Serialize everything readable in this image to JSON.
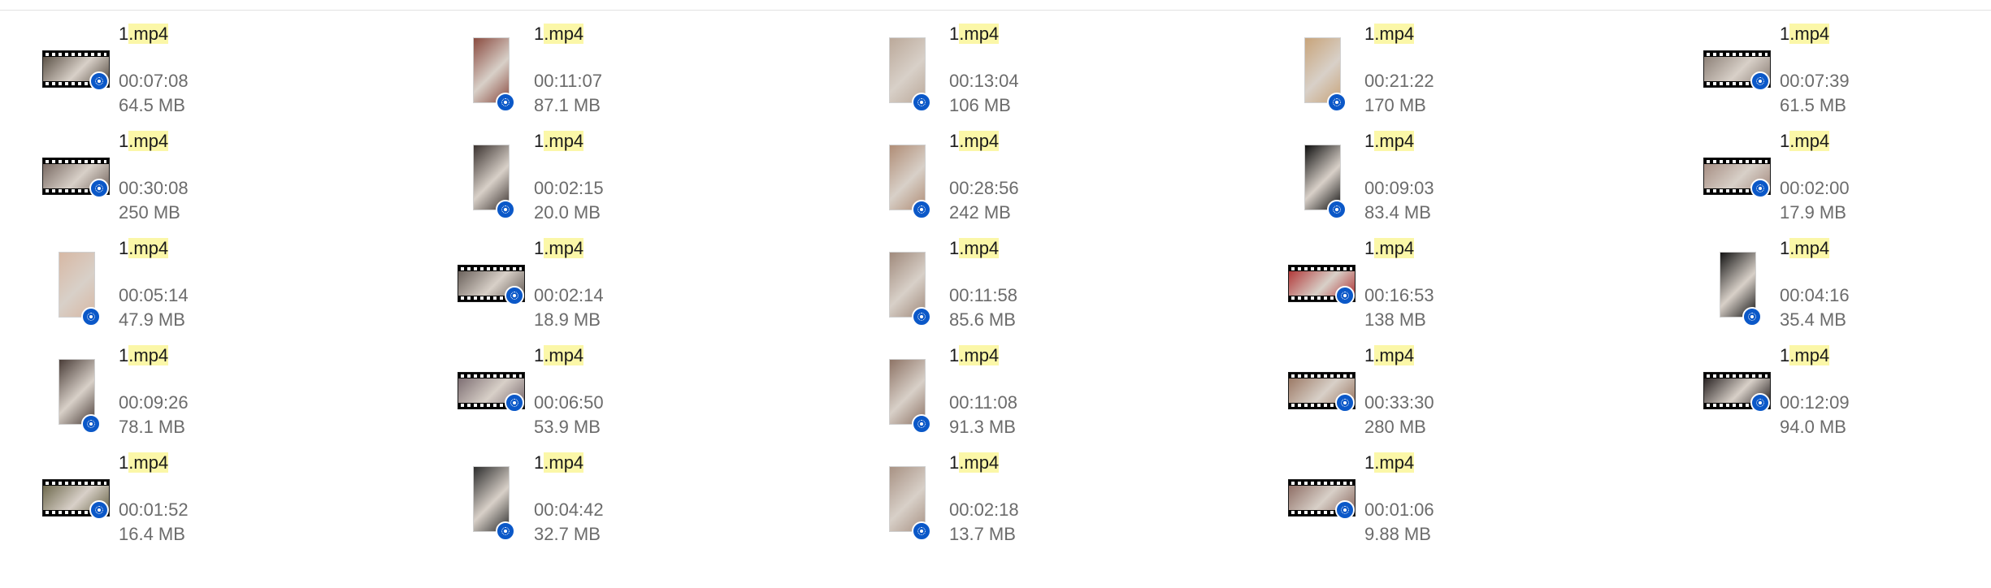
{
  "file_view": {
    "files": [
      {
        "name_prefix": "1",
        "name_highlight": ".mp4",
        "duration": "00:07:08",
        "size": "64.5 MB",
        "thumb_orientation": "landscape",
        "thumb_color": "#5d5348",
        "icon": "video-player-badge-icon"
      },
      {
        "name_prefix": "1",
        "name_highlight": ".mp4",
        "duration": "00:11:07",
        "size": "87.1 MB",
        "thumb_orientation": "portrait",
        "thumb_color": "#8a4b40",
        "icon": "video-player-badge-icon"
      },
      {
        "name_prefix": "1",
        "name_highlight": ".mp4",
        "duration": "00:13:04",
        "size": "106 MB",
        "thumb_orientation": "portrait",
        "thumb_color": "#bba99a",
        "icon": "video-player-badge-icon"
      },
      {
        "name_prefix": "1",
        "name_highlight": ".mp4",
        "duration": "00:21:22",
        "size": "170 MB",
        "thumb_orientation": "portrait",
        "thumb_color": "#c8a47a",
        "icon": "video-player-badge-icon"
      },
      {
        "name_prefix": "1",
        "name_highlight": ".mp4",
        "duration": "00:07:39",
        "size": "61.5 MB",
        "thumb_orientation": "landscape",
        "thumb_color": "#8d8178",
        "icon": "video-player-badge-icon"
      },
      {
        "name_prefix": "1",
        "name_highlight": ".mp4",
        "duration": "00:30:08",
        "size": "250 MB",
        "thumb_orientation": "landscape",
        "thumb_color": "#7a6b64",
        "icon": "video-player-badge-icon"
      },
      {
        "name_prefix": "1",
        "name_highlight": ".mp4",
        "duration": "00:02:15",
        "size": "20.0 MB",
        "thumb_orientation": "portrait",
        "thumb_color": "#3b3330",
        "icon": "video-player-badge-icon"
      },
      {
        "name_prefix": "1",
        "name_highlight": ".mp4",
        "duration": "00:28:56",
        "size": "242 MB",
        "thumb_orientation": "portrait",
        "thumb_color": "#b08d76",
        "icon": "video-player-badge-icon"
      },
      {
        "name_prefix": "1",
        "name_highlight": ".mp4",
        "duration": "00:09:03",
        "size": "83.4 MB",
        "thumb_orientation": "portrait",
        "thumb_color": "#0f0f0f",
        "icon": "video-player-badge-icon"
      },
      {
        "name_prefix": "1",
        "name_highlight": ".mp4",
        "duration": "00:02:00",
        "size": "17.9 MB",
        "thumb_orientation": "landscape",
        "thumb_color": "#a78f84",
        "icon": "video-player-badge-icon"
      },
      {
        "name_prefix": "1",
        "name_highlight": ".mp4",
        "duration": "00:05:14",
        "size": "47.9 MB",
        "thumb_orientation": "portrait",
        "thumb_color": "#d7b8a4",
        "icon": "video-player-badge-icon"
      },
      {
        "name_prefix": "1",
        "name_highlight": ".mp4",
        "duration": "00:02:14",
        "size": "18.9 MB",
        "thumb_orientation": "landscape",
        "thumb_color": "#6b625c",
        "icon": "video-player-badge-icon"
      },
      {
        "name_prefix": "1",
        "name_highlight": ".mp4",
        "duration": "00:11:58",
        "size": "85.6 MB",
        "thumb_orientation": "portrait",
        "thumb_color": "#a08a7c",
        "icon": "video-player-badge-icon"
      },
      {
        "name_prefix": "1",
        "name_highlight": ".mp4",
        "duration": "00:16:53",
        "size": "138 MB",
        "thumb_orientation": "landscape",
        "thumb_color": "#b23a3a",
        "icon": "video-player-badge-icon"
      },
      {
        "name_prefix": "1",
        "name_highlight": ".mp4",
        "duration": "00:04:16",
        "size": "35.4 MB",
        "thumb_orientation": "portrait",
        "thumb_color": "#141414",
        "icon": "video-player-badge-icon"
      },
      {
        "name_prefix": "1",
        "name_highlight": ".mp4",
        "duration": "00:09:26",
        "size": "78.1 MB",
        "thumb_orientation": "portrait",
        "thumb_color": "#4a3d38",
        "icon": "video-player-badge-icon"
      },
      {
        "name_prefix": "1",
        "name_highlight": ".mp4",
        "duration": "00:06:50",
        "size": "53.9 MB",
        "thumb_orientation": "landscape",
        "thumb_color": "#7e6f73",
        "icon": "video-player-badge-icon"
      },
      {
        "name_prefix": "1",
        "name_highlight": ".mp4",
        "duration": "00:11:08",
        "size": "91.3 MB",
        "thumb_orientation": "portrait",
        "thumb_color": "#8e7466",
        "icon": "video-player-badge-icon"
      },
      {
        "name_prefix": "1",
        "name_highlight": ".mp4",
        "duration": "00:33:30",
        "size": "280 MB",
        "thumb_orientation": "landscape",
        "thumb_color": "#9c7a66",
        "icon": "video-player-badge-icon"
      },
      {
        "name_prefix": "1",
        "name_highlight": ".mp4",
        "duration": "00:12:09",
        "size": "94.0 MB",
        "thumb_orientation": "landscape",
        "thumb_color": "#2a2424",
        "icon": "video-player-badge-icon"
      },
      {
        "name_prefix": "1",
        "name_highlight": ".mp4",
        "duration": "00:01:52",
        "size": "16.4 MB",
        "thumb_orientation": "landscape",
        "thumb_color": "#6f6a4e",
        "icon": "video-player-badge-icon"
      },
      {
        "name_prefix": "1",
        "name_highlight": ".mp4",
        "duration": "00:04:42",
        "size": "32.7 MB",
        "thumb_orientation": "portrait",
        "thumb_color": "#2c2c2c",
        "icon": "video-player-badge-icon"
      },
      {
        "name_prefix": "1",
        "name_highlight": ".mp4",
        "duration": "00:02:18",
        "size": "13.7 MB",
        "thumb_orientation": "portrait",
        "thumb_color": "#a89284",
        "icon": "video-player-badge-icon"
      },
      {
        "name_prefix": "1",
        "name_highlight": ".mp4",
        "duration": "00:01:06",
        "size": "9.88 MB",
        "thumb_orientation": "landscape",
        "thumb_color": "#8f6f66",
        "icon": "video-player-badge-icon"
      }
    ]
  }
}
